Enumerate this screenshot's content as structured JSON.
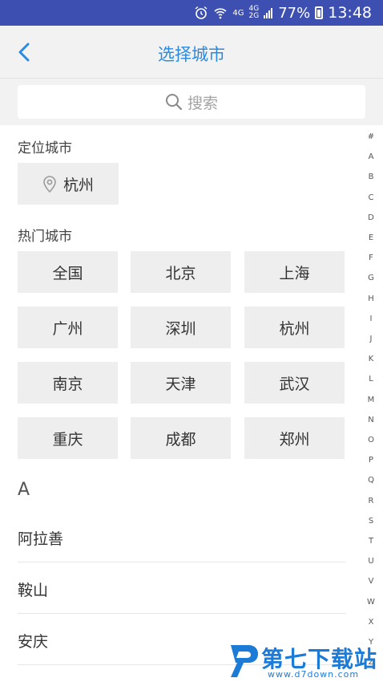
{
  "status_bar": {
    "network_top": "4G",
    "network_mid_a": "4G",
    "network_mid_b": "2G",
    "battery": "77%",
    "time": "13:48"
  },
  "nav": {
    "title": "选择城市"
  },
  "search": {
    "placeholder": "搜索"
  },
  "location": {
    "label": "定位城市",
    "city": "杭州"
  },
  "hot": {
    "label": "热门城市",
    "cities": [
      "全国",
      "北京",
      "上海",
      "广州",
      "深圳",
      "杭州",
      "南京",
      "天津",
      "武汉",
      "重庆",
      "成都",
      "郑州"
    ]
  },
  "list": {
    "letter": "A",
    "cities": [
      "阿拉善",
      "鞍山",
      "安庆"
    ]
  },
  "index": [
    "#",
    "A",
    "B",
    "C",
    "D",
    "E",
    "F",
    "G",
    "H",
    "I",
    "J",
    "K",
    "L",
    "M",
    "N",
    "O",
    "P",
    "Q",
    "R",
    "S",
    "T",
    "U",
    "V",
    "W",
    "X",
    "Y",
    "Z"
  ],
  "watermark": {
    "main": "第七下载站",
    "sub": "www.d7down.com"
  },
  "colors": {
    "status_bar": "#3d4fb0",
    "accent": "#2b8be0",
    "chip_bg": "#eeeeee",
    "watermark": "#1d7bd8"
  }
}
